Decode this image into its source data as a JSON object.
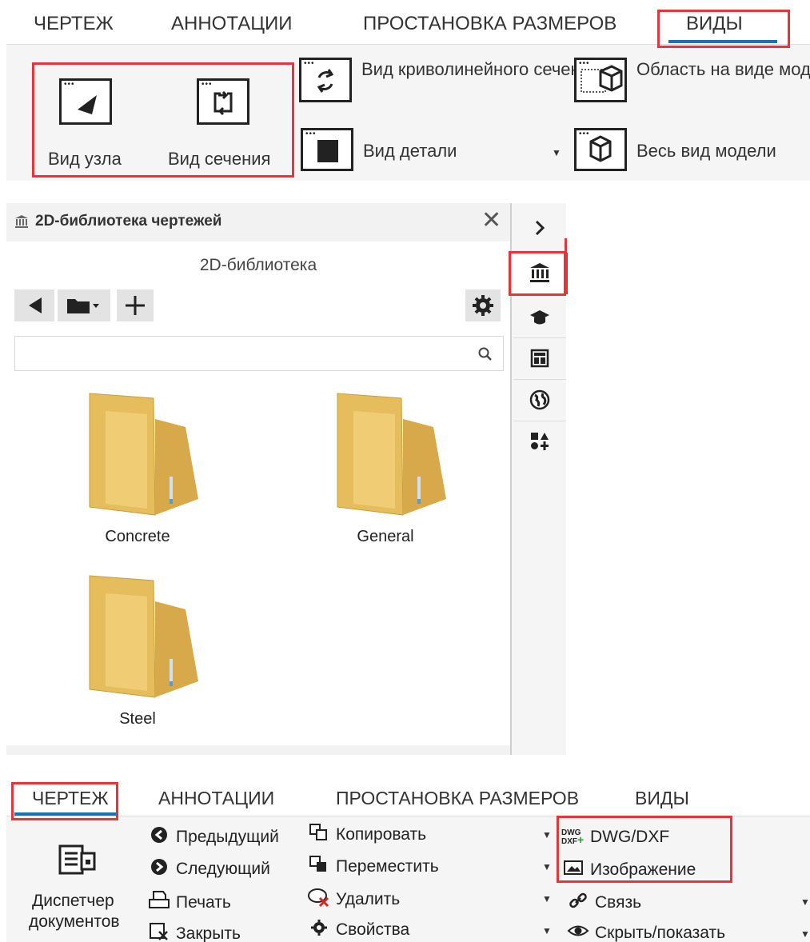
{
  "ribbon_top": {
    "tabs": [
      {
        "label": "ЧЕРТЕЖ"
      },
      {
        "label": "АННОТАЦИИ"
      },
      {
        "label": "ПРОСТАНОВКА РАЗМЕРОВ"
      },
      {
        "label": "ВИДЫ",
        "active": true
      }
    ],
    "detail_view": "Вид узла",
    "section_view": "Вид сечения",
    "curved_section_view": "Вид криволинейного сечения",
    "detail_part_view": "Вид детали",
    "model_region_view": "Область на виде модели",
    "full_model_view": "Весь вид модели"
  },
  "library": {
    "title": "2D-библиотека чертежей",
    "subtitle": "2D-библиотека",
    "search_placeholder": "",
    "folders": [
      "Concrete",
      "General",
      "Steel"
    ]
  },
  "side_rail": {
    "icons": [
      "chevron-right-icon",
      "library-icon",
      "graduation-cap-icon",
      "layout-icon",
      "globe-icon",
      "shapes-icon"
    ]
  },
  "ribbon_bottom": {
    "tabs": [
      {
        "label": "ЧЕРТЕЖ",
        "active": true
      },
      {
        "label": "АННОТАЦИИ"
      },
      {
        "label": "ПРОСТАНОВКА РАЗМЕРОВ"
      },
      {
        "label": "ВИДЫ"
      }
    ],
    "doc_manager_line1": "Диспетчер",
    "doc_manager_line2": "документов",
    "previous": "Предыдущий",
    "next": "Следующий",
    "print": "Печать",
    "close": "Закрыть",
    "copy": "Копировать",
    "move": "Переместить",
    "delete": "Удалить",
    "properties": "Свойства",
    "dwg_dxf": "DWG/DXF",
    "image": "Изображение",
    "link": "Связь",
    "hide_show": "Скрыть/показать"
  },
  "colors": {
    "highlight": "#e8333a",
    "tab_underline": "#1f6fb3",
    "folder": "#e9c46a"
  }
}
